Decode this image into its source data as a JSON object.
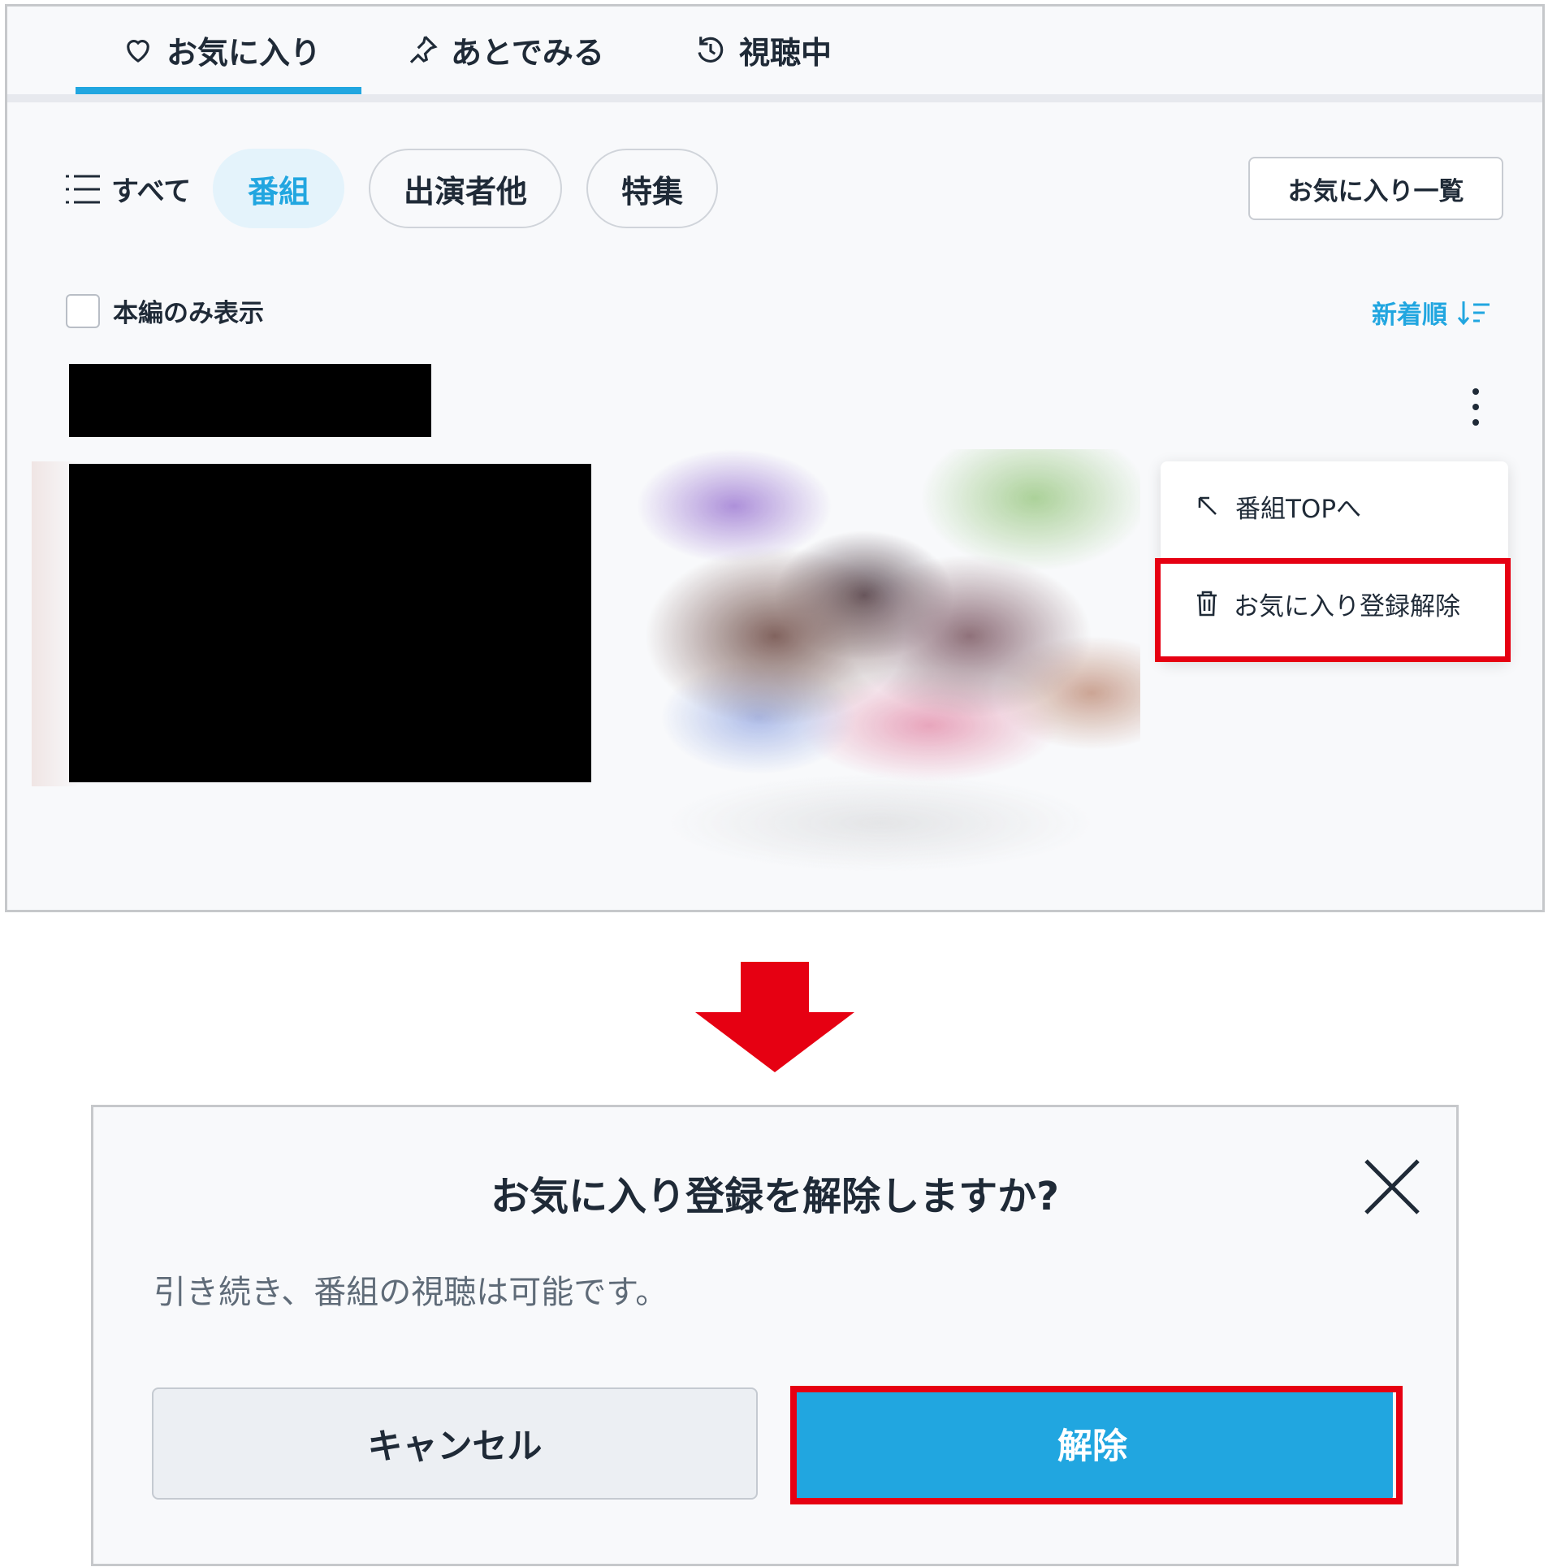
{
  "tabs": [
    {
      "label": "お気に入り",
      "icon": "heart-icon"
    },
    {
      "label": "あとでみる",
      "icon": "pin-icon"
    },
    {
      "label": "視聴中",
      "icon": "history-icon"
    }
  ],
  "filters": {
    "all_label": "すべて",
    "chips": [
      "番組",
      "出演者他",
      "特集"
    ],
    "favorites_list_label": "お気に入り一覧"
  },
  "options": {
    "main_only_label": "本編のみ表示",
    "sort_label": "新着順"
  },
  "context_menu": {
    "items": [
      {
        "label": "番組TOPへ",
        "icon": "arrow-up-left-icon"
      },
      {
        "label": "お気に入り登録解除",
        "icon": "trash-icon"
      }
    ]
  },
  "dialog": {
    "title": "お気に入り登録を解除しますか?",
    "message": "引き続き、番組の視聴は可能です。",
    "cancel_label": "キャンセル",
    "confirm_label": "解除"
  },
  "colors": {
    "accent": "#21a6e0",
    "highlight": "#e60012",
    "text": "#1f2a37"
  }
}
